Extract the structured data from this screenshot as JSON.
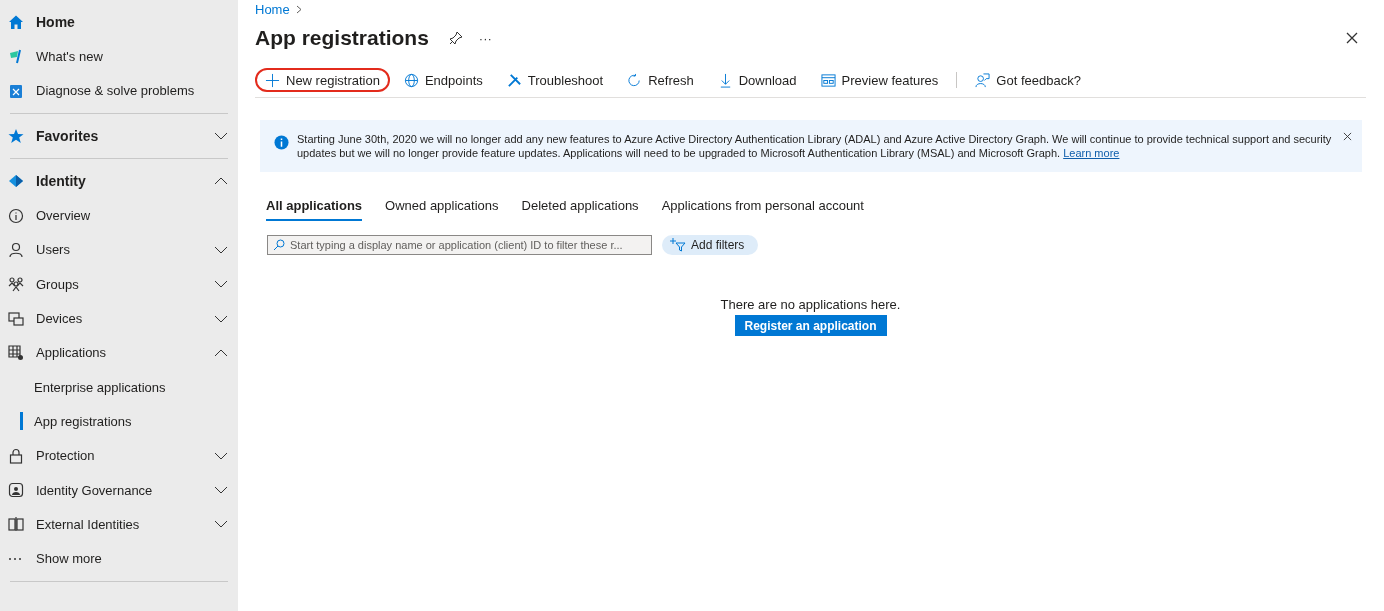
{
  "sidebar": {
    "groups": [
      {
        "items": [
          {
            "label": "Home",
            "kind": "top"
          },
          {
            "label": "What's new",
            "kind": "link"
          },
          {
            "label": "Diagnose & solve problems",
            "kind": "link"
          }
        ]
      },
      {
        "items": [
          {
            "label": "Favorites",
            "kind": "top",
            "expanded": false
          }
        ]
      },
      {
        "items": [
          {
            "label": "Identity",
            "kind": "top",
            "expanded": true
          },
          {
            "label": "Overview",
            "kind": "link"
          },
          {
            "label": "Users",
            "kind": "link",
            "expanded": false
          },
          {
            "label": "Groups",
            "kind": "link",
            "expanded": false
          },
          {
            "label": "Devices",
            "kind": "link",
            "expanded": false
          },
          {
            "label": "Applications",
            "kind": "link",
            "expanded": true,
            "children": [
              {
                "label": "Enterprise applications",
                "selected": false
              },
              {
                "label": "App registrations",
                "selected": true
              }
            ]
          },
          {
            "label": "Protection",
            "kind": "link",
            "expanded": false
          },
          {
            "label": "Identity Governance",
            "kind": "link",
            "expanded": false
          },
          {
            "label": "External Identities",
            "kind": "link",
            "expanded": false
          },
          {
            "label": "Show more",
            "kind": "more"
          }
        ]
      }
    ]
  },
  "breadcrumb": [
    "Home"
  ],
  "page": {
    "title": "App registrations",
    "more": "···"
  },
  "toolbar": [
    {
      "label": "New registration",
      "circled": true
    },
    {
      "label": "Endpoints",
      "circled": false
    },
    {
      "label": "Troubleshoot",
      "circled": false
    },
    {
      "label": "Refresh",
      "circled": false
    },
    {
      "label": "Download",
      "circled": false
    },
    {
      "label": "Preview features",
      "circled": false
    },
    {
      "label": "Got feedback?",
      "circled": false
    }
  ],
  "banner": {
    "text": "Starting June 30th, 2020 we will no longer add any new features to Azure Active Directory Authentication Library (ADAL) and Azure Active Directory Graph. We will continue to provide technical support and security updates but we will no longer provide feature updates. Applications will need to be upgraded to Microsoft Authentication Library (MSAL) and Microsoft Graph.",
    "link": "Learn more"
  },
  "tabs": [
    {
      "label": "All applications",
      "selected": true
    },
    {
      "label": "Owned applications",
      "selected": false
    },
    {
      "label": "Deleted applications",
      "selected": false
    },
    {
      "label": "Applications from personal account",
      "selected": false
    }
  ],
  "search": {
    "placeholder": "Start typing a display name or application (client) ID to filter these r..."
  },
  "filter_button": "Add filters",
  "empty": {
    "message": "There are no applications here.",
    "button": "Register an application"
  }
}
